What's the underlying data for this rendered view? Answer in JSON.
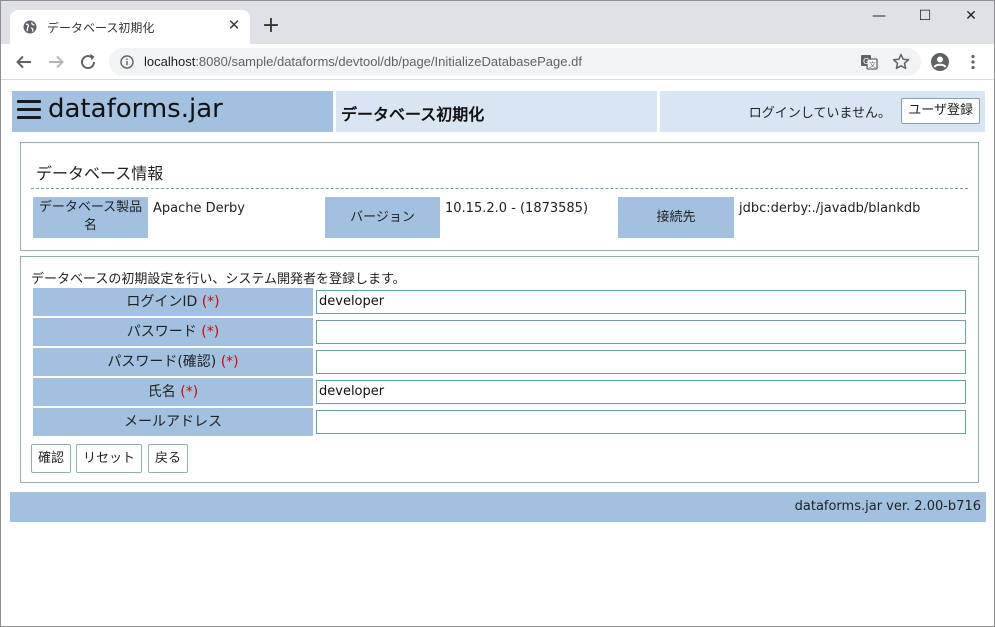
{
  "browser": {
    "tab_title": "データベース初期化",
    "tab_close": "✕",
    "new_tab": "+",
    "url_host": "localhost",
    "url_rest": ":8080/sample/dataforms/devtool/db/page/InitializeDatabasePage.df",
    "window_minimize": "—",
    "window_maximize": "☐",
    "window_close": "✕"
  },
  "header": {
    "brand": "dataforms.jar",
    "page_title": "データベース初期化",
    "login_status": "ログインしていません。",
    "register_button": "ユーザ登録"
  },
  "db_info": {
    "legend": "データベース情報",
    "product_label": "データベース製品名",
    "product_value": "Apache Derby",
    "version_label": "バージョン",
    "version_value": "10.15.2.0 - (1873585)",
    "connection_label": "接続先",
    "connection_value": "jdbc:derby:./javadb/blankdb"
  },
  "form": {
    "description": "データベースの初期設定を行い、システム開発者を登録します。",
    "required_mark": "(*)",
    "fields": [
      {
        "label": "ログインID",
        "value": "developer"
      },
      {
        "label": "パスワード",
        "value": ""
      },
      {
        "label": "パスワード(確認)",
        "value": ""
      },
      {
        "label": "氏名",
        "value": "developer"
      },
      {
        "label": "メールアドレス",
        "value": ""
      }
    ],
    "buttons": {
      "confirm": "確認",
      "reset": "リセット",
      "back": "戻る"
    }
  },
  "footer": {
    "version": "dataforms.jar ver. 2.00-b716"
  }
}
